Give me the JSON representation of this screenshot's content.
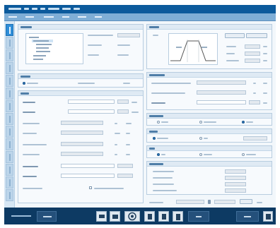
{
  "colors": {
    "menubar": "#0c5a9c",
    "toolbar": "#7faed6",
    "sidebar": "#d7e7f4",
    "sidebar_active_tab": "#2f8ed8",
    "content_background": "#f2f7fb",
    "panel_border": "#b8cde0",
    "footer": "#0d3a63",
    "chart_curve": "#555555"
  },
  "icons": {
    "monitor": "monitor-icon",
    "print": "print-icon",
    "lock": "lock-icon",
    "delete": "trash-icon",
    "device": "device-icon",
    "exit": "exit-icon"
  },
  "sidebar": {
    "tab_count": 14,
    "active_tab_index": 0
  }
}
